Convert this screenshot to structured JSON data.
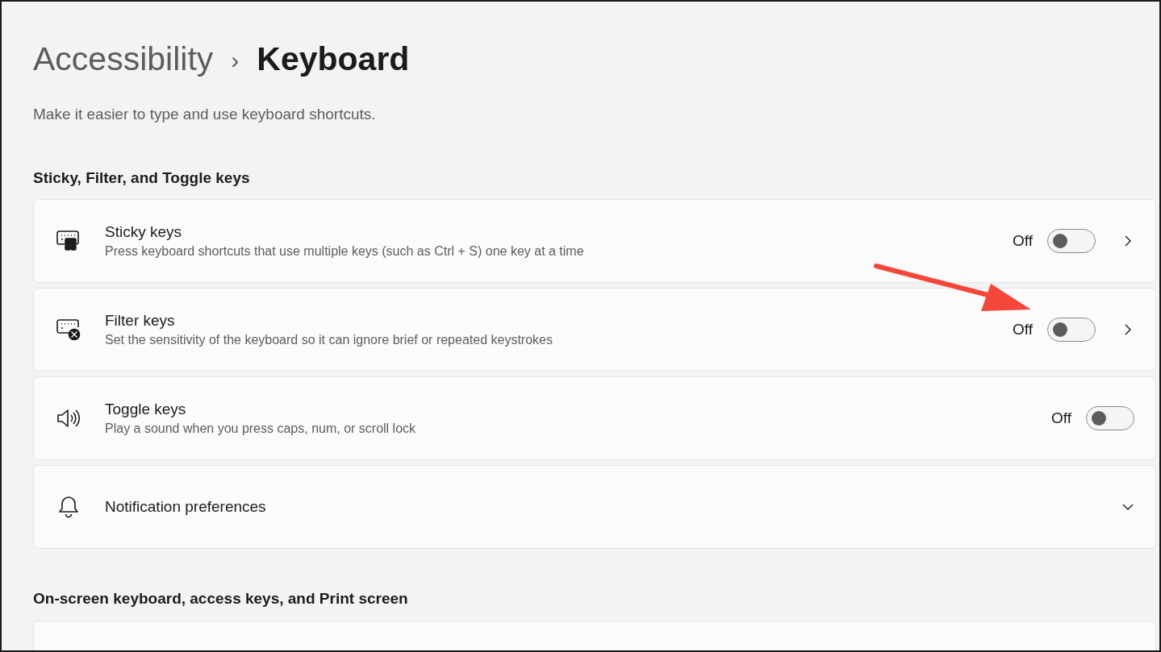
{
  "breadcrumb": {
    "parent": "Accessibility",
    "separator": "›",
    "current": "Keyboard"
  },
  "description": "Make it easier to type and use keyboard shortcuts.",
  "sections": [
    {
      "title": "Sticky, Filter, and Toggle keys",
      "items": [
        {
          "kind": "toggle-link",
          "title": "Sticky keys",
          "subtitle": "Press keyboard shortcuts that use multiple keys (such as Ctrl + S) one key at a time",
          "state_label": "Off",
          "on": false
        },
        {
          "kind": "toggle-link",
          "title": "Filter keys",
          "subtitle": "Set the sensitivity of the keyboard so it can ignore brief or repeated keystrokes",
          "state_label": "Off",
          "on": false
        },
        {
          "kind": "toggle",
          "title": "Toggle keys",
          "subtitle": "Play a sound when you press caps, num, or scroll lock",
          "state_label": "Off",
          "on": false
        },
        {
          "kind": "expand",
          "title": "Notification preferences",
          "expanded": false
        }
      ]
    },
    {
      "title": "On-screen keyboard, access keys, and Print screen",
      "items": [
        {
          "kind": "cut"
        }
      ]
    }
  ],
  "annotation": {
    "kind": "arrow"
  }
}
